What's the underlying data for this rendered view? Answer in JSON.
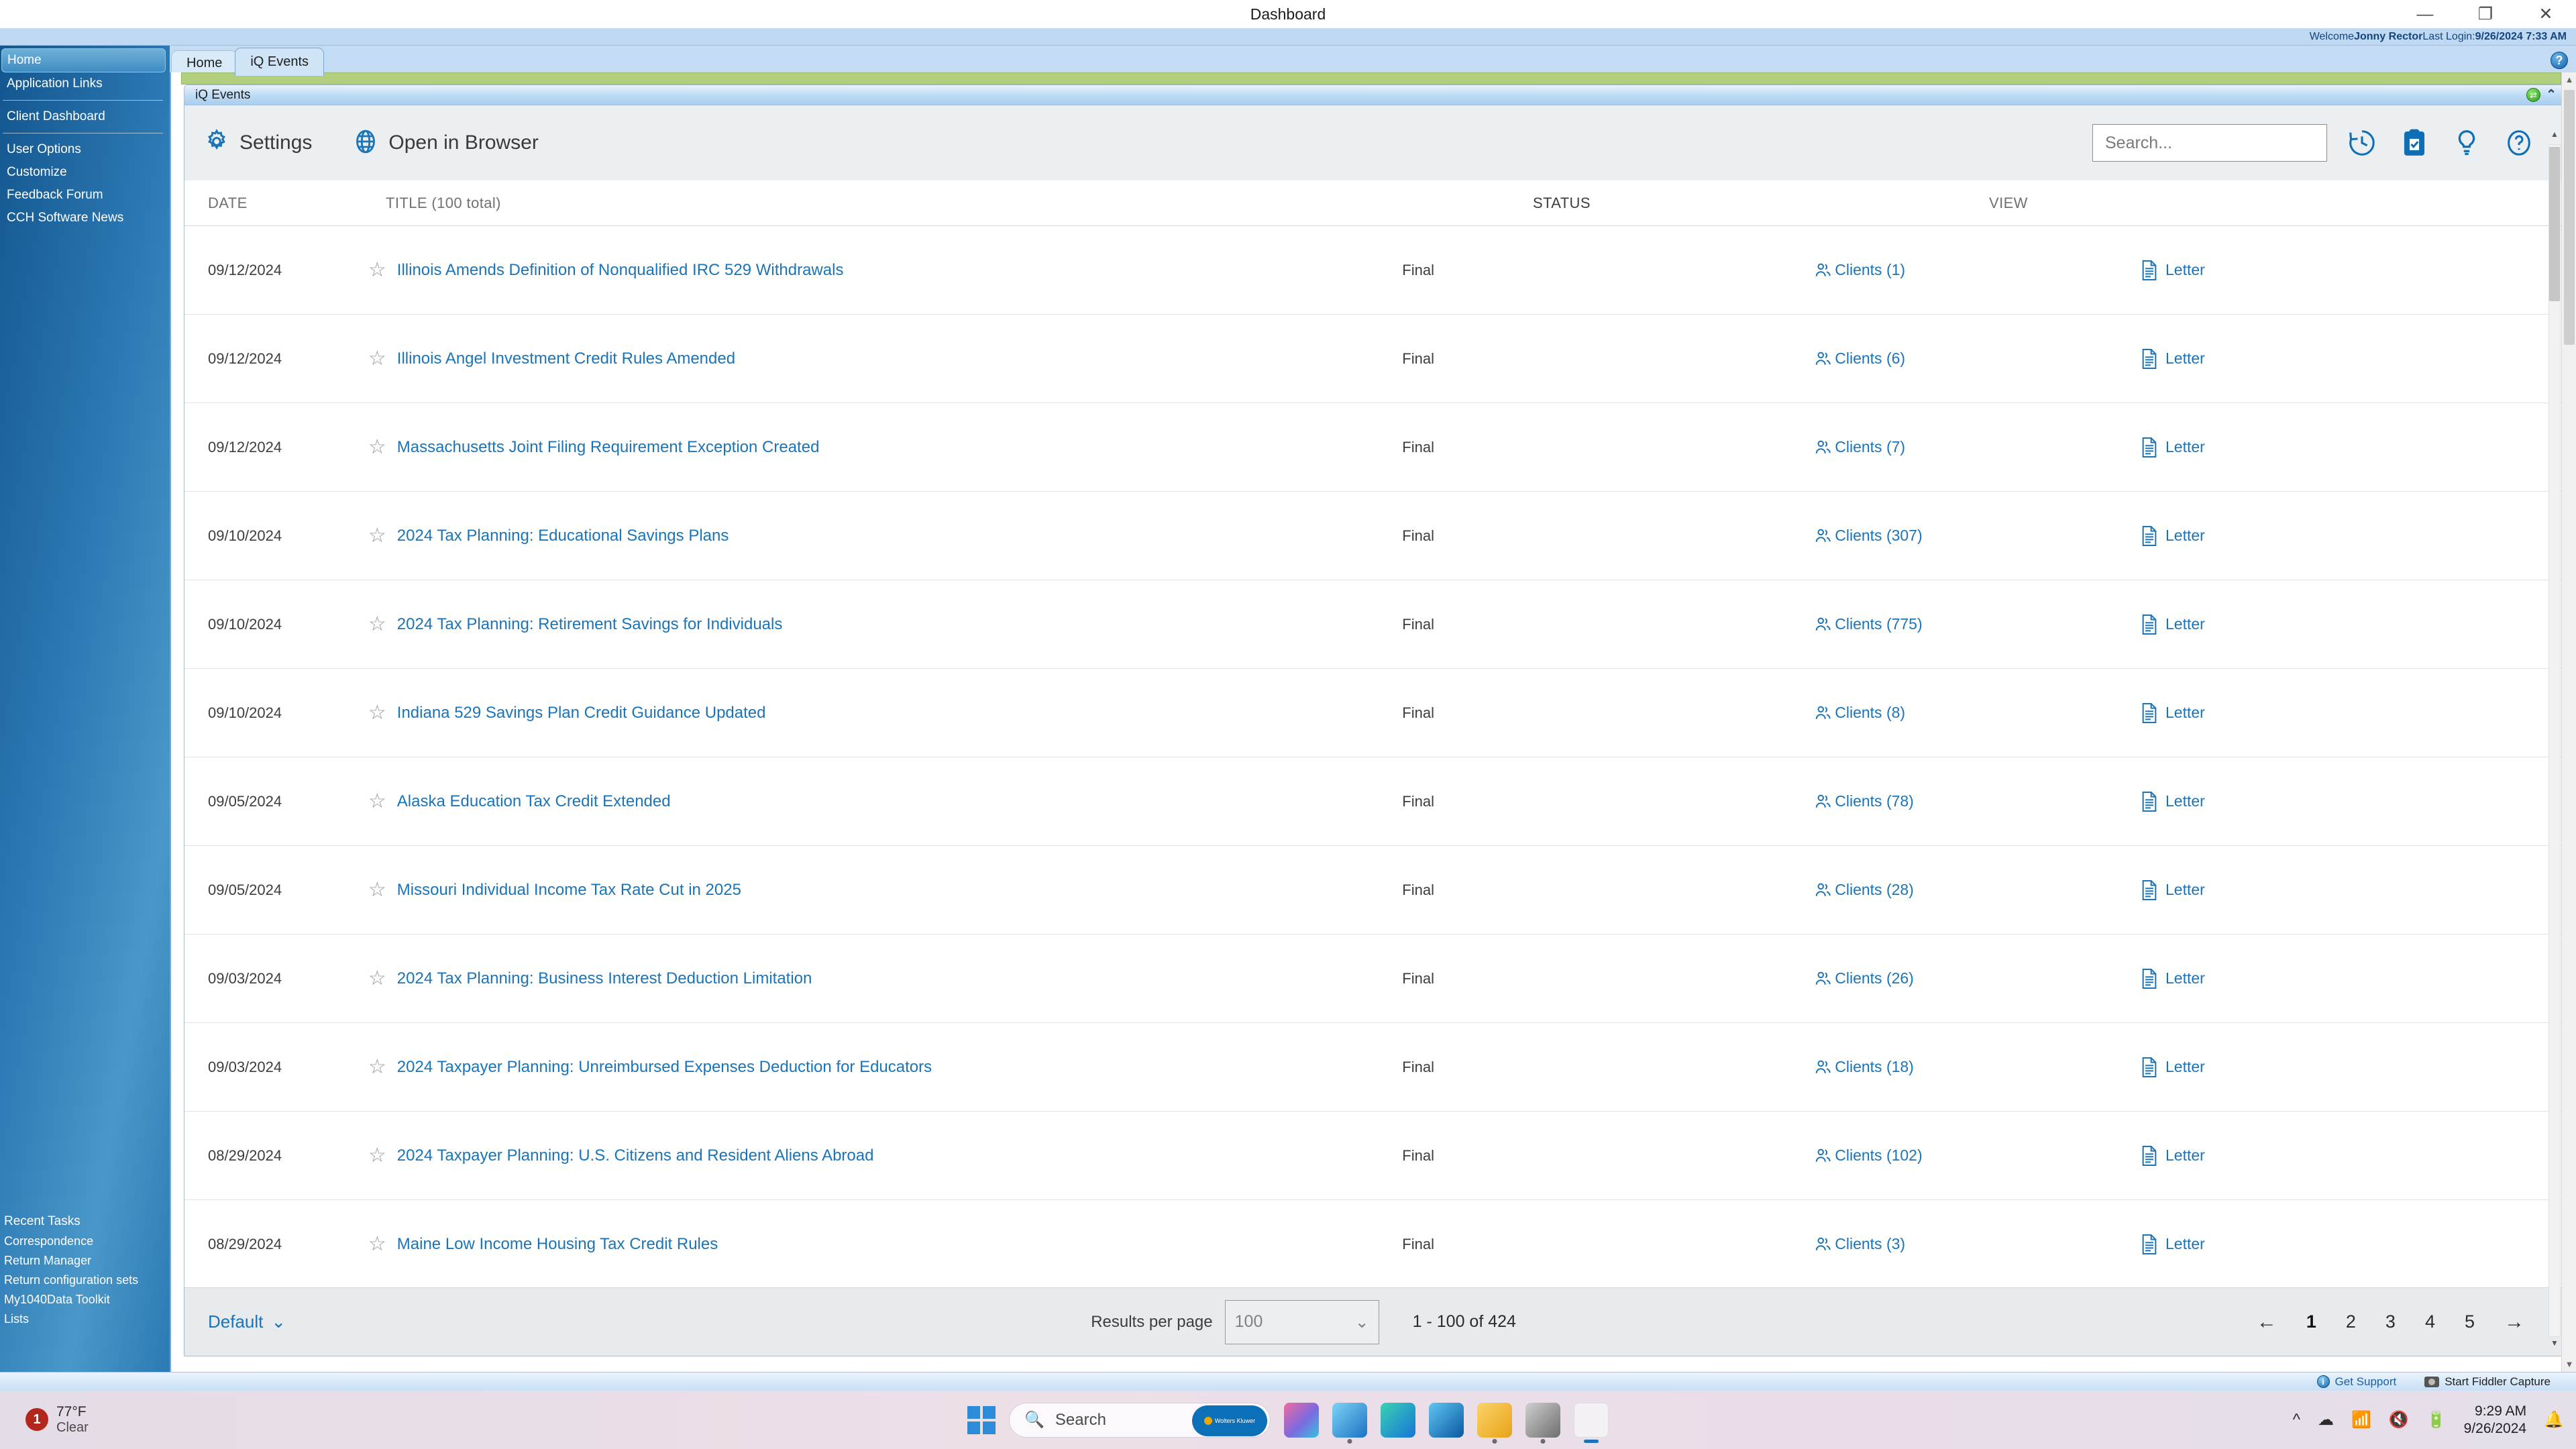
{
  "window": {
    "title": "Dashboard",
    "minimize": "—",
    "restore": "❐",
    "close": "✕"
  },
  "welcome": {
    "prefix": "Welcome ",
    "user": "Jonny Rector",
    "login_label": " Last Login: ",
    "login_time": "9/26/2024 7:33 AM",
    "help_icon": "help-globe-icon"
  },
  "tabs": [
    {
      "label": "Home",
      "active": false
    },
    {
      "label": "iQ Events",
      "active": true
    }
  ],
  "sidebar": {
    "items": [
      {
        "label": "Home",
        "selected": true
      },
      {
        "label": "Application Links",
        "selected": false
      },
      {
        "label": "Client Dashboard",
        "selected": false
      },
      {
        "label": "User Options",
        "selected": false
      },
      {
        "label": "Customize",
        "selected": false
      },
      {
        "label": "Feedback Forum",
        "selected": false
      },
      {
        "label": "CCH Software News",
        "selected": false
      }
    ],
    "recent_tasks_title": "Recent Tasks",
    "recent_tasks": [
      "Correspondence",
      "Return Manager",
      "Return configuration sets",
      "My1040Data Toolkit",
      "Lists"
    ]
  },
  "panel": {
    "title": "iQ Events",
    "refresh_icon": "refresh-icon",
    "collapse_icon": "chevron-up-icon"
  },
  "toolbar": {
    "settings_label": "Settings",
    "settings_icon": "gear-icon",
    "browser_label": "Open in Browser",
    "browser_icon": "globe-icon",
    "search_placeholder": "Search...",
    "search_value": "",
    "icons": [
      {
        "name": "history-icon",
        "title": "History"
      },
      {
        "name": "clipboard-check-icon",
        "title": "Tasks"
      },
      {
        "name": "lightbulb-icon",
        "title": "Tips"
      },
      {
        "name": "help-circle-icon",
        "title": "Help"
      }
    ]
  },
  "table": {
    "columns": [
      "DATE",
      "TITLE  (100 total)",
      "STATUS",
      "VIEW"
    ],
    "star_icon": "star-outline-icon",
    "clients_icon": "clients-icon",
    "letter_icon": "document-icon",
    "rows": [
      {
        "date": "09/12/2024",
        "title": "Illinois Amends Definition of Nonqualified IRC 529 Withdrawals",
        "status": "Final",
        "clients": "Clients (1)",
        "view": "Letter"
      },
      {
        "date": "09/12/2024",
        "title": "Illinois Angel Investment Credit Rules Amended",
        "status": "Final",
        "clients": "Clients (6)",
        "view": "Letter"
      },
      {
        "date": "09/12/2024",
        "title": "Massachusetts Joint Filing Requirement Exception Created",
        "status": "Final",
        "clients": "Clients (7)",
        "view": "Letter"
      },
      {
        "date": "09/10/2024",
        "title": "2024 Tax Planning: Educational Savings Plans",
        "status": "Final",
        "clients": "Clients (307)",
        "view": "Letter"
      },
      {
        "date": "09/10/2024",
        "title": "2024 Tax Planning: Retirement Savings for Individuals",
        "status": "Final",
        "clients": "Clients (775)",
        "view": "Letter"
      },
      {
        "date": "09/10/2024",
        "title": "Indiana 529 Savings Plan Credit Guidance Updated",
        "status": "Final",
        "clients": "Clients (8)",
        "view": "Letter"
      },
      {
        "date": "09/05/2024",
        "title": "Alaska Education Tax Credit Extended",
        "status": "Final",
        "clients": "Clients (78)",
        "view": "Letter"
      },
      {
        "date": "09/05/2024",
        "title": "Missouri Individual Income Tax Rate Cut in 2025",
        "status": "Final",
        "clients": "Clients (28)",
        "view": "Letter"
      },
      {
        "date": "09/03/2024",
        "title": "2024 Tax Planning: Business Interest Deduction Limitation",
        "status": "Final",
        "clients": "Clients (26)",
        "view": "Letter"
      },
      {
        "date": "09/03/2024",
        "title": "2024 Taxpayer Planning: Unreimbursed Expenses Deduction for Educators",
        "status": "Final",
        "clients": "Clients (18)",
        "view": "Letter"
      },
      {
        "date": "08/29/2024",
        "title": "2024 Taxpayer Planning: U.S. Citizens and Resident Aliens Abroad",
        "status": "Final",
        "clients": "Clients (102)",
        "view": "Letter"
      },
      {
        "date": "08/29/2024",
        "title": "Maine Low Income Housing Tax Credit Rules",
        "status": "Final",
        "clients": "Clients (3)",
        "view": "Letter"
      }
    ]
  },
  "footer": {
    "view_selector": "Default",
    "view_selector_caret": "chevron-down-icon",
    "results_per_page_label": "Results per page",
    "results_per_page_value": "100",
    "range_text": "1 - 100 of 424",
    "prev_arrow": "←",
    "next_arrow": "→",
    "pages": [
      "1",
      "2",
      "3",
      "4",
      "5"
    ],
    "current_page": "1"
  },
  "statusbar": {
    "get_support": "Get Support",
    "get_support_icon": "info-icon",
    "fiddler": "Start Fiddler Capture",
    "fiddler_icon": "camera-icon"
  },
  "taskbar": {
    "weather_badge": "1",
    "weather_temp": "77°F",
    "weather_cond": "Clear",
    "start_icon": "windows-start-icon",
    "search_placeholder": "Search",
    "search_icon": "search-icon",
    "wk_brand": "Wolters Kluwer",
    "apps": [
      {
        "name": "copilot-pre-icon",
        "running": false
      },
      {
        "name": "outlook-blue-icon",
        "running": true
      },
      {
        "name": "edge-icon",
        "running": false
      },
      {
        "name": "outlook-icon",
        "running": false
      },
      {
        "name": "file-explorer-icon",
        "running": true
      },
      {
        "name": "meter-icon",
        "running": true
      },
      {
        "name": "snipping-tool-icon",
        "running": true
      }
    ],
    "tray": {
      "chevron": "^",
      "onedrive_icon": "cloud-icon",
      "wifi_icon": "wifi-icon",
      "volume_icon": "volume-mute-icon",
      "battery_icon": "battery-charging-icon",
      "time": "9:29 AM",
      "date": "9/26/2024",
      "notifications_icon": "bell-icon"
    }
  },
  "colors": {
    "accent_blue": "#1b74b8",
    "sidebar_blue": "#2d7ab5",
    "welcome_bar": "#bfd9f2",
    "green_bar": "#b2cf7e"
  }
}
